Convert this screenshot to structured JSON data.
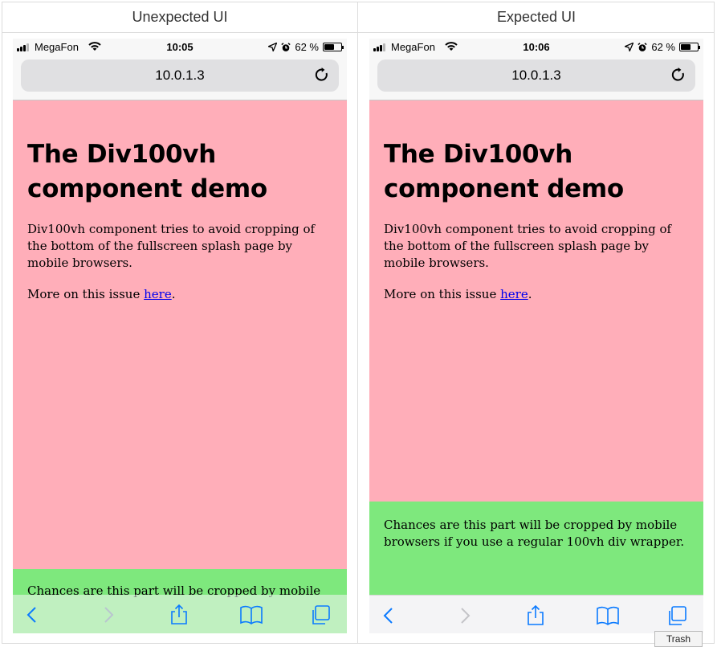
{
  "columns": {
    "left_header": "Unexpected UI",
    "right_header": "Expected UI"
  },
  "phones": [
    {
      "carrier": "MegaFon",
      "time": "10:05",
      "battery": "62 %",
      "battery_level": 0.62,
      "url": "10.0.1.3",
      "title": "The Div100vh component demo",
      "description": "Div100vh component tries to avoid cropping of the bottom of the fullscreen splash page by mobile browsers.",
      "more_prefix": "More on this issue ",
      "more_link": "here",
      "more_suffix": ".",
      "footer_text": "Chances are this part will be cropped by mobile"
    },
    {
      "carrier": "MegaFon",
      "time": "10:06",
      "battery": "62 %",
      "battery_level": 0.62,
      "url": "10.0.1.3",
      "title": "The Div100vh component demo",
      "description": "Div100vh component tries to avoid cropping of the bottom of the fullscreen splash page by mobile browsers.",
      "more_prefix": "More on this issue ",
      "more_link": "here",
      "more_suffix": ".",
      "footer_text": "Chances are this part will be cropped by mobile browsers if you use a regular 100vh div wrapper."
    }
  ],
  "colors": {
    "pink_background": "#ffaeb9",
    "green_background": "#7ee87d",
    "link": "#0000ee",
    "toolbar_icon": "#0a7aff"
  },
  "icons": [
    "signal-bars-icon",
    "wifi-icon",
    "location-arrow-icon",
    "alarm-clock-icon",
    "battery-icon",
    "reload-icon",
    "back-icon",
    "forward-icon",
    "share-icon",
    "bookmarks-icon",
    "tabs-icon"
  ],
  "tooltip": {
    "label": "Trash"
  }
}
